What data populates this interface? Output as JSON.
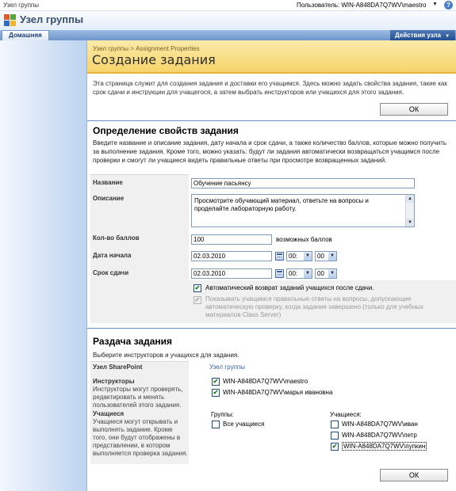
{
  "topbar": {
    "site_link": "Узел группы",
    "user_label": "Пользователь: WIN-A848DA7Q7WV\\maestro",
    "help": "?"
  },
  "header": {
    "site_title": "Узел группы"
  },
  "nav": {
    "home_tab": "Домашняя",
    "site_actions": "Действия узла"
  },
  "page": {
    "breadcrumb": "Узел группы > Assignment Properties",
    "title": "Создание задания",
    "intro": "Эта страница служит для создания задания и доставки его учащимся. Здесь можно задать свойства задания, такие как срок сдачи и инструкции для учащегося, а затем выбрать инструкторов или учащихся для этого задания.",
    "ok_label": "ОК"
  },
  "properties": {
    "title": "Определение свойств задания",
    "description": "Введите название и описание задания, дату начала и срок сдачи, а также количество баллов, которые можно получить за выполнение задания. Кроме того, можно указать: будут ли задания автоматически возвращаться учащимся после проверки и смогут ли учащиеся видеть правильные ответы при просмотре возвращенных заданий.",
    "name_label": "Название",
    "name_value": "Обучение пасьянсу",
    "desc_label": "Описание",
    "desc_value": "Просмотрите обучающий материал, ответьте на вопросы и проделайте лабораторную работу.",
    "points_label": "Кол-во баллов",
    "points_value": "100",
    "points_suffix": "возможных баллов",
    "start_label": "Дата начала",
    "start_date": "02.03.2010",
    "start_hour": "00:",
    "start_min": "00",
    "due_label": "Срок сдачи",
    "due_date": "02.03.2010",
    "due_hour": "00:",
    "due_min": "00",
    "auto_return_label": "Автоматический возврат заданий учащихся после сдачи.",
    "auto_return_checked": true,
    "show_answers_label": "Показывать учащимся правильные ответы на вопросы, допускающие автоматическую проверку, когда задание завершено (только для учебных материалов Class Server)",
    "show_answers_checked": false
  },
  "distribution": {
    "title": "Раздача задания",
    "description": "Выберите инструкторов и учащихся для задания.",
    "site_label": "Узел SharePoint",
    "site_value": "Узел группы",
    "instructors_label": "Инструкторы",
    "instructors_desc": "Инструкторы могут проверять, редактировать и менять пользователей этого задания.",
    "instructors": [
      {
        "name": "WIN-A848DA7Q7WV\\maestro",
        "checked": true
      },
      {
        "name": "WIN-A848DA7Q7WV\\марья ивановна",
        "checked": true
      }
    ],
    "learners_label": "Учащиеся",
    "learners_desc": "Учащиеся могут открывать и выполнять задание. Кроме того, они будут отображены в представлении, в котором выполняется проверка задания.",
    "groups_header": "Группы:",
    "all_learners": "Все учащиеся",
    "all_learners_checked": false,
    "learners_header": "Учащиеся:",
    "learners": [
      {
        "name": "WIN-A848DA7Q7WV\\иван",
        "checked": false
      },
      {
        "name": "WIN-A848DA7Q7WV\\петр",
        "checked": false
      },
      {
        "name": "WIN-A848DA7Q7WV\\пупкин",
        "checked": true
      }
    ]
  },
  "colors": {
    "page_header": "#f7d46b",
    "nav_blue": "#6f96cc",
    "rule": "#6b8fc8",
    "link": "#3a62a8"
  }
}
